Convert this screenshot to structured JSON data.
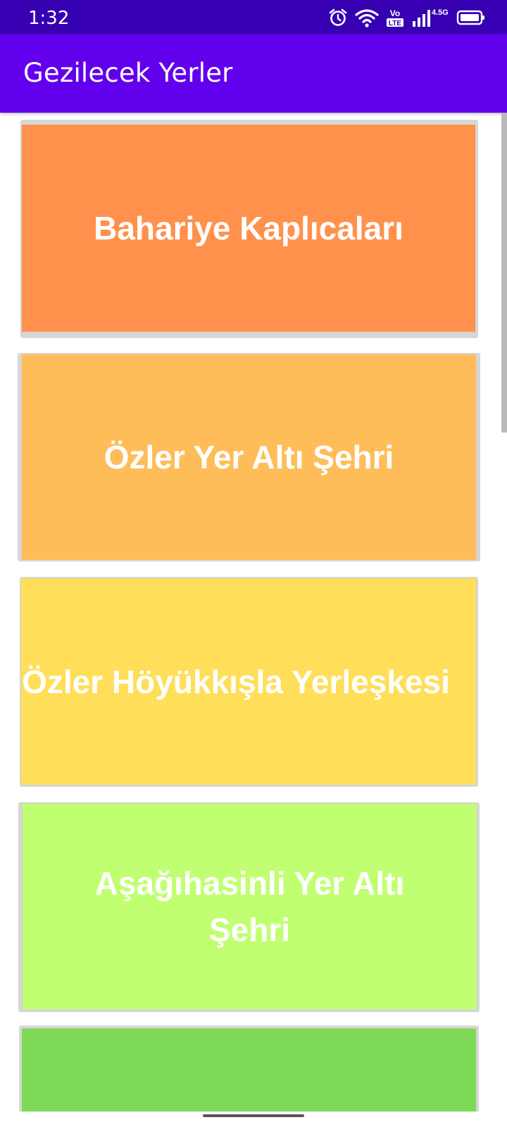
{
  "status_bar": {
    "time": "1:32",
    "background": "#3700b3",
    "icons": [
      "alarm-icon",
      "wifi-icon",
      "volte-icon",
      "signal-icon",
      "battery-icon"
    ],
    "network_label": "4.5G",
    "volte_top": "Vo",
    "volte_bottom": "LTE"
  },
  "app_bar": {
    "title": "Gezilecek Yerler",
    "background": "#6200ee"
  },
  "places": [
    {
      "name": "Bahariye Kaplıcaları",
      "color": "#ff914d"
    },
    {
      "name": "Özler Yer Altı Şehri",
      "color": "#ffbd59"
    },
    {
      "name": "Özler Höyükkışla Yerleşkesi",
      "color": "#ffde59"
    },
    {
      "name": "Aşağıhasinli Yer Altı Şehri",
      "color": "#c1ff72"
    },
    {
      "name": "",
      "color": "#7ed957"
    }
  ]
}
